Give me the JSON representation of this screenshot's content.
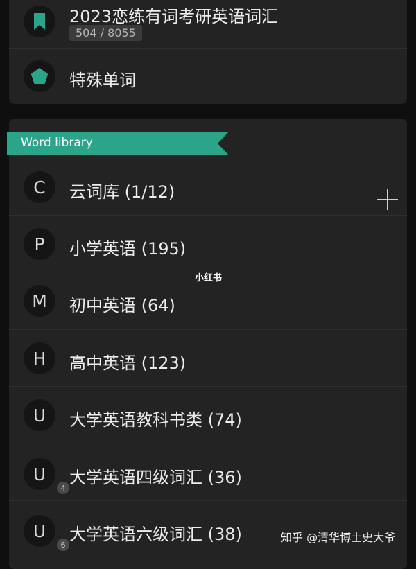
{
  "top_card": {
    "book_title": "2023恋练有词考研英语词汇",
    "book_progress": "504 / 8055",
    "special_words_label": "特殊单词"
  },
  "library": {
    "section_title": "Word library",
    "items": [
      {
        "letter": "C",
        "label": "云词库 (1/12)",
        "badge": ""
      },
      {
        "letter": "P",
        "label": "小学英语 (195)",
        "badge": ""
      },
      {
        "letter": "M",
        "label": "初中英语 (64)",
        "badge": ""
      },
      {
        "letter": "H",
        "label": "高中英语 (123)",
        "badge": ""
      },
      {
        "letter": "U",
        "label": "大学英语教科书类 (74)",
        "badge": ""
      },
      {
        "letter": "U",
        "label": "大学英语四级词汇 (36)",
        "badge": "4"
      },
      {
        "letter": "U",
        "label": "大学英语六级词汇 (38)",
        "badge": "6"
      }
    ]
  },
  "watermarks": {
    "center": "小红书",
    "bottom": "知乎 @清华博士史大爷"
  },
  "colors": {
    "accent": "#2aa58a",
    "card_bg": "#232323",
    "page_bg": "#0f0f0f"
  },
  "icons": {
    "book": "bookmark-icon",
    "special": "pentagon-icon",
    "add": "plus-icon"
  }
}
